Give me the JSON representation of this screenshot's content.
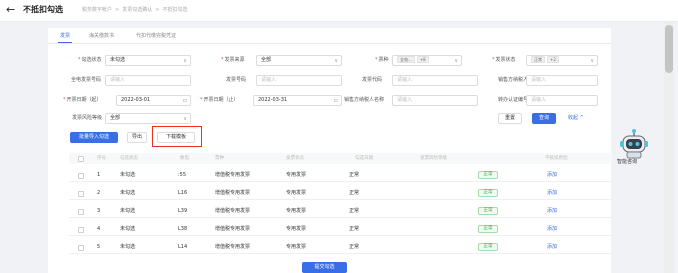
{
  "header": {
    "back_glyph": "←",
    "title": "不抵扣勾选",
    "breadcrumb": [
      "税务数字帐户",
      "发票勾选确认",
      "不抵扣勾选"
    ],
    "breadcrumb_sep": ">"
  },
  "tabs": [
    {
      "label": "发票"
    },
    {
      "label": "海关缴款书"
    },
    {
      "label": "代扣代缴完税凭证"
    }
  ],
  "filters": {
    "check_status": {
      "label": "勾选状态",
      "value": "未勾选"
    },
    "invoice_source": {
      "label": "发票来源",
      "value": "全部"
    },
    "ticket_type": {
      "label": "票种",
      "tag1": "全电...",
      "tag2": "+8"
    },
    "invoice_status": {
      "label": "发票状态",
      "tag1": "正常",
      "tag2": "+2"
    },
    "full_invoice_no": {
      "label": "全电发票号码",
      "placeholder": "请输入"
    },
    "invoice_no": {
      "label": "发票号码",
      "placeholder": "请输入"
    },
    "invoice_code": {
      "label": "发票代码",
      "placeholder": "请输入"
    },
    "seller_tax_id": {
      "label": "销售方纳税人识...",
      "placeholder": "请输入"
    },
    "issue_date_from": {
      "label": "开票日期（起）",
      "value": "2022-03-01"
    },
    "issue_date_to": {
      "label": "开票日期（止）",
      "value": "2022-03-31"
    },
    "seller_name": {
      "label": "销售方纳税人名称",
      "placeholder": "请输入"
    },
    "seller_branch": {
      "label": "转办认证编号",
      "placeholder": "请输入"
    },
    "risk_level": {
      "label": "发票风险等级",
      "value": "全部"
    }
  },
  "buttons": {
    "reset": "重置",
    "query": "查询",
    "collapse": "收起",
    "collapse_glyph": "^",
    "import": "批量导入勾选",
    "export": "导出",
    "download": "下载模板",
    "submit": "提交勾选"
  },
  "table": {
    "headers": [
      "序号",
      "勾选状态",
      "数电",
      "票种",
      "发票状态",
      "勾选日期",
      "发票风险等级",
      "不抵扣原因"
    ],
    "rows": [
      {
        "index": "1",
        "status": "未勾选",
        "no": ":55",
        "type": "增值税专用发票",
        "kind": "专用发票",
        "state": "正常",
        "risk": "正常",
        "action": "添加"
      },
      {
        "index": "2",
        "status": "未勾选",
        "no": "L16",
        "type": "增值税专用发票",
        "kind": "专用发票",
        "state": "正常",
        "risk": "正常",
        "action": "添加"
      },
      {
        "index": "3",
        "status": "未勾选",
        "no": "L39",
        "type": "增值税专用发票",
        "kind": "专用发票",
        "state": "正常",
        "risk": "正常",
        "action": "添加"
      },
      {
        "index": "4",
        "status": "未勾选",
        "no": "L38",
        "type": "增值税专用发票",
        "kind": "专用发票",
        "state": "正常",
        "risk": "正常",
        "action": "添加"
      },
      {
        "index": "5",
        "status": "未勾选",
        "no": "L14",
        "type": "增值税专用发票",
        "kind": "专用发票",
        "state": "正常",
        "risk": "正常",
        "action": "添加"
      }
    ]
  },
  "assistant": {
    "label": "智能咨询"
  },
  "colors": {
    "accent": "#3a6ee8",
    "highlight": "#e8321c",
    "success": "#3aa24e"
  },
  "icons": {
    "caret": "∨",
    "calendar": "▫"
  }
}
